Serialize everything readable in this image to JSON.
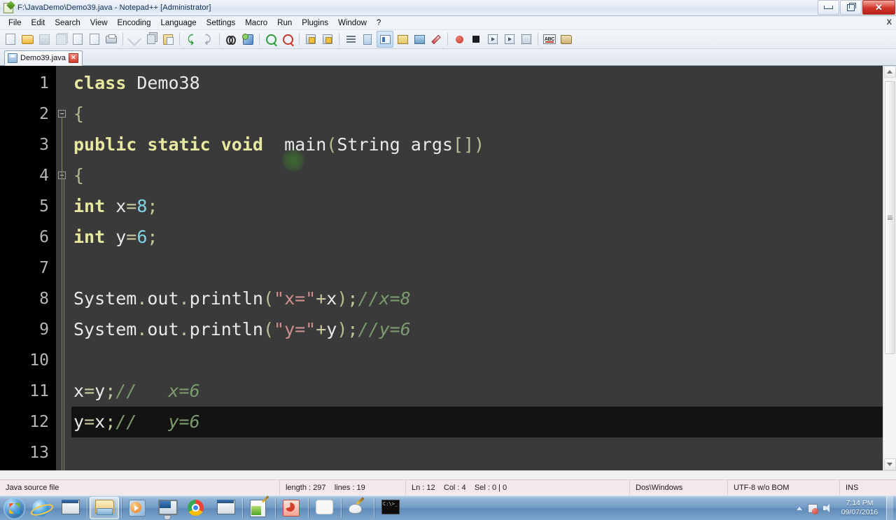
{
  "window": {
    "title": "F:\\JavaDemo\\Demo39.java - Notepad++ [Administrator]",
    "icon": "notepad-plus-plus-icon",
    "controls": {
      "minimize": "–",
      "restore": "❐",
      "close": "✕"
    }
  },
  "menubar": {
    "items": [
      {
        "label": "File"
      },
      {
        "label": "Edit"
      },
      {
        "label": "Search"
      },
      {
        "label": "View"
      },
      {
        "label": "Encoding"
      },
      {
        "label": "Language"
      },
      {
        "label": "Settings"
      },
      {
        "label": "Macro"
      },
      {
        "label": "Run"
      },
      {
        "label": "Plugins"
      },
      {
        "label": "Window"
      },
      {
        "label": "?"
      }
    ],
    "close_document": "X"
  },
  "toolbar": {
    "buttons": [
      {
        "name": "new-file-icon"
      },
      {
        "name": "open-file-icon"
      },
      {
        "name": "save-icon"
      },
      {
        "name": "save-all-icon"
      },
      {
        "name": "close-file-icon"
      },
      {
        "name": "close-all-icon"
      },
      {
        "name": "print-icon"
      },
      {
        "name": "cut-icon"
      },
      {
        "name": "copy-icon"
      },
      {
        "name": "paste-icon"
      },
      {
        "name": "undo-icon"
      },
      {
        "name": "redo-icon"
      },
      {
        "name": "find-icon"
      },
      {
        "name": "replace-icon"
      },
      {
        "name": "zoom-in-icon"
      },
      {
        "name": "zoom-out-icon"
      },
      {
        "name": "sync-vertical-icon"
      },
      {
        "name": "sync-horizontal-icon"
      },
      {
        "name": "word-wrap-icon"
      },
      {
        "name": "all-chars-icon"
      },
      {
        "name": "indent-guide-icon"
      },
      {
        "name": "ui-user-defined-icon"
      },
      {
        "name": "doc-map-icon"
      },
      {
        "name": "doc-switcher-icon"
      },
      {
        "name": "record-macro-icon"
      },
      {
        "name": "stop-macro-icon"
      },
      {
        "name": "play-macro-icon"
      },
      {
        "name": "play-multiple-macro-icon"
      },
      {
        "name": "save-macro-icon"
      },
      {
        "name": "spellcheck-icon"
      },
      {
        "name": "file-browser-icon"
      }
    ]
  },
  "tabs": [
    {
      "label": "Demo39.java",
      "icon": "saved-file-icon",
      "close": "✕",
      "active": true
    }
  ],
  "editor": {
    "current_line": 12,
    "fold_markers": [
      2,
      4
    ],
    "lines": [
      {
        "n": "1",
        "tokens": [
          {
            "t": "class",
            "c": "kw"
          },
          {
            "t": " ",
            "c": "id"
          },
          {
            "t": "Demo38",
            "c": "id"
          }
        ]
      },
      {
        "n": "2",
        "tokens": [
          {
            "t": "{",
            "c": "br"
          }
        ]
      },
      {
        "n": "3",
        "tokens": [
          {
            "t": "public",
            "c": "kw"
          },
          {
            "t": " ",
            "c": "id"
          },
          {
            "t": "static",
            "c": "kw"
          },
          {
            "t": " ",
            "c": "id"
          },
          {
            "t": "void",
            "c": "kw"
          },
          {
            "t": "  ",
            "c": "id"
          },
          {
            "t": "main",
            "c": "id"
          },
          {
            "t": "(",
            "c": "pn"
          },
          {
            "t": "String",
            "c": "id"
          },
          {
            "t": " args",
            "c": "id"
          },
          {
            "t": "[]",
            "c": "pn"
          },
          {
            "t": ")",
            "c": "pn"
          }
        ]
      },
      {
        "n": "4",
        "tokens": [
          {
            "t": "{",
            "c": "br"
          }
        ]
      },
      {
        "n": "5",
        "tokens": [
          {
            "t": "int",
            "c": "kw"
          },
          {
            "t": " ",
            "c": "id"
          },
          {
            "t": "x",
            "c": "id"
          },
          {
            "t": "=",
            "c": "op"
          },
          {
            "t": "8",
            "c": "num"
          },
          {
            "t": ";",
            "c": "op"
          }
        ]
      },
      {
        "n": "6",
        "tokens": [
          {
            "t": "int",
            "c": "kw"
          },
          {
            "t": " ",
            "c": "id"
          },
          {
            "t": "y",
            "c": "id"
          },
          {
            "t": "=",
            "c": "op"
          },
          {
            "t": "6",
            "c": "num"
          },
          {
            "t": ";",
            "c": "op"
          }
        ]
      },
      {
        "n": "7",
        "tokens": []
      },
      {
        "n": "8",
        "tokens": [
          {
            "t": "System",
            "c": "id"
          },
          {
            "t": ".",
            "c": "op"
          },
          {
            "t": "out",
            "c": "id"
          },
          {
            "t": ".",
            "c": "op"
          },
          {
            "t": "println",
            "c": "id"
          },
          {
            "t": "(",
            "c": "pn"
          },
          {
            "t": "\"x=\"",
            "c": "str"
          },
          {
            "t": "+",
            "c": "op"
          },
          {
            "t": "x",
            "c": "id"
          },
          {
            "t": ")",
            "c": "pn"
          },
          {
            "t": ";",
            "c": "op"
          },
          {
            "t": "//x=8",
            "c": "cmt"
          }
        ]
      },
      {
        "n": "9",
        "tokens": [
          {
            "t": "System",
            "c": "id"
          },
          {
            "t": ".",
            "c": "op"
          },
          {
            "t": "out",
            "c": "id"
          },
          {
            "t": ".",
            "c": "op"
          },
          {
            "t": "println",
            "c": "id"
          },
          {
            "t": "(",
            "c": "pn"
          },
          {
            "t": "\"y=\"",
            "c": "str"
          },
          {
            "t": "+",
            "c": "op"
          },
          {
            "t": "y",
            "c": "id"
          },
          {
            "t": ")",
            "c": "pn"
          },
          {
            "t": ";",
            "c": "op"
          },
          {
            "t": "//y=6",
            "c": "cmt"
          }
        ]
      },
      {
        "n": "10",
        "tokens": []
      },
      {
        "n": "11",
        "tokens": [
          {
            "t": "x",
            "c": "id"
          },
          {
            "t": "=",
            "c": "op"
          },
          {
            "t": "y",
            "c": "id"
          },
          {
            "t": ";",
            "c": "op"
          },
          {
            "t": "//   x=6",
            "c": "cmt"
          }
        ]
      },
      {
        "n": "12",
        "tokens": [
          {
            "t": "y",
            "c": "id"
          },
          {
            "t": "=",
            "c": "op"
          },
          {
            "t": "x",
            "c": "id"
          },
          {
            "t": ";",
            "c": "op"
          },
          {
            "t": "//   y=6",
            "c": "cmt"
          }
        ]
      },
      {
        "n": "13",
        "tokens": []
      }
    ]
  },
  "statusbar": {
    "file_type": "Java source file",
    "length": "length : 297",
    "lines": "lines : 19",
    "ln": "Ln : 12",
    "col": "Col : 4",
    "sel": "Sel : 0 | 0",
    "eol": "Dos\\Windows",
    "encoding": "UTF-8 w/o BOM",
    "insert_mode": "INS"
  },
  "taskbar": {
    "start": "start-orb-icon",
    "items": [
      {
        "name": "taskbar-internet-explorer",
        "icon": "ie-icon"
      },
      {
        "name": "taskbar-windows-app",
        "icon": "window-icon"
      },
      {
        "name": "taskbar-file-explorer",
        "icon": "folder-icon",
        "active": true
      },
      {
        "name": "taskbar-media-player",
        "icon": "media-player-icon"
      },
      {
        "name": "taskbar-display",
        "icon": "monitor-icon"
      },
      {
        "name": "taskbar-chrome",
        "icon": "chrome-icon"
      },
      {
        "name": "taskbar-app",
        "icon": "blue-app-icon"
      },
      {
        "name": "taskbar-notepad-plus-plus",
        "icon": "notepad-plus-plus-icon"
      },
      {
        "name": "taskbar-powerpoint",
        "icon": "powerpoint-icon"
      },
      {
        "name": "taskbar-white-app",
        "icon": "white-app-icon"
      },
      {
        "name": "taskbar-paint",
        "icon": "paint-icon"
      },
      {
        "name": "taskbar-command-prompt",
        "icon": "command-prompt-icon"
      }
    ],
    "tray": {
      "show_hidden": "show-hidden-icons-arrow",
      "action_center": "action-center-flag-icon",
      "volume": "volume-icon",
      "time": "7:14 PM",
      "date": "09/07/2016"
    },
    "cmd_text": "C:\\>_"
  }
}
